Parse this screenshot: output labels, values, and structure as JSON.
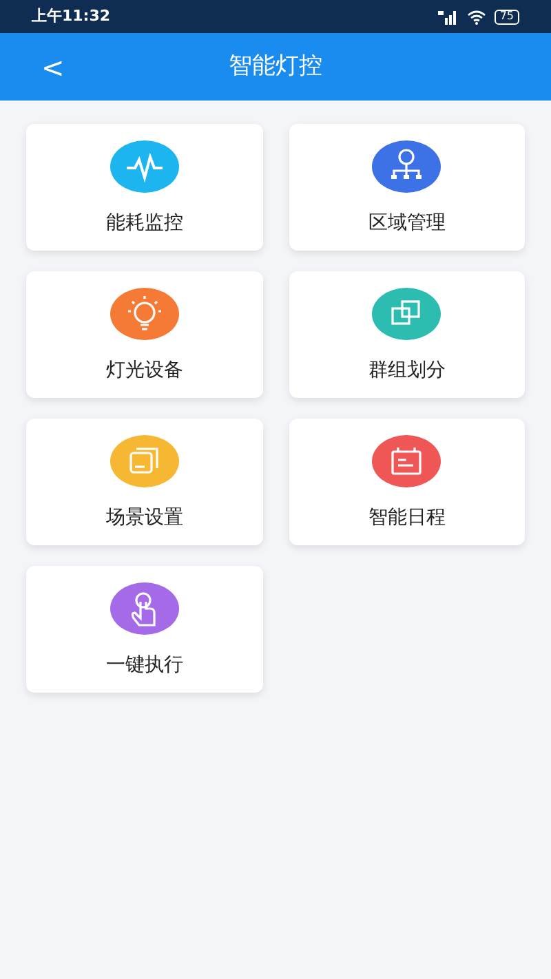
{
  "status_bar": {
    "time": "上午11:32",
    "battery": "75"
  },
  "header": {
    "back": "<",
    "title": "智能灯控"
  },
  "tiles": [
    {
      "label": "能耗监控",
      "color": "#1cb5f0"
    },
    {
      "label": "区域管理",
      "color": "#3d72e6"
    },
    {
      "label": "灯光设备",
      "color": "#f47a35"
    },
    {
      "label": "群组划分",
      "color": "#2cbcb0"
    },
    {
      "label": "场景设置",
      "color": "#f6b733"
    },
    {
      "label": "智能日程",
      "color": "#ef5656"
    },
    {
      "label": "一键执行",
      "color": "#a46ae8"
    }
  ]
}
